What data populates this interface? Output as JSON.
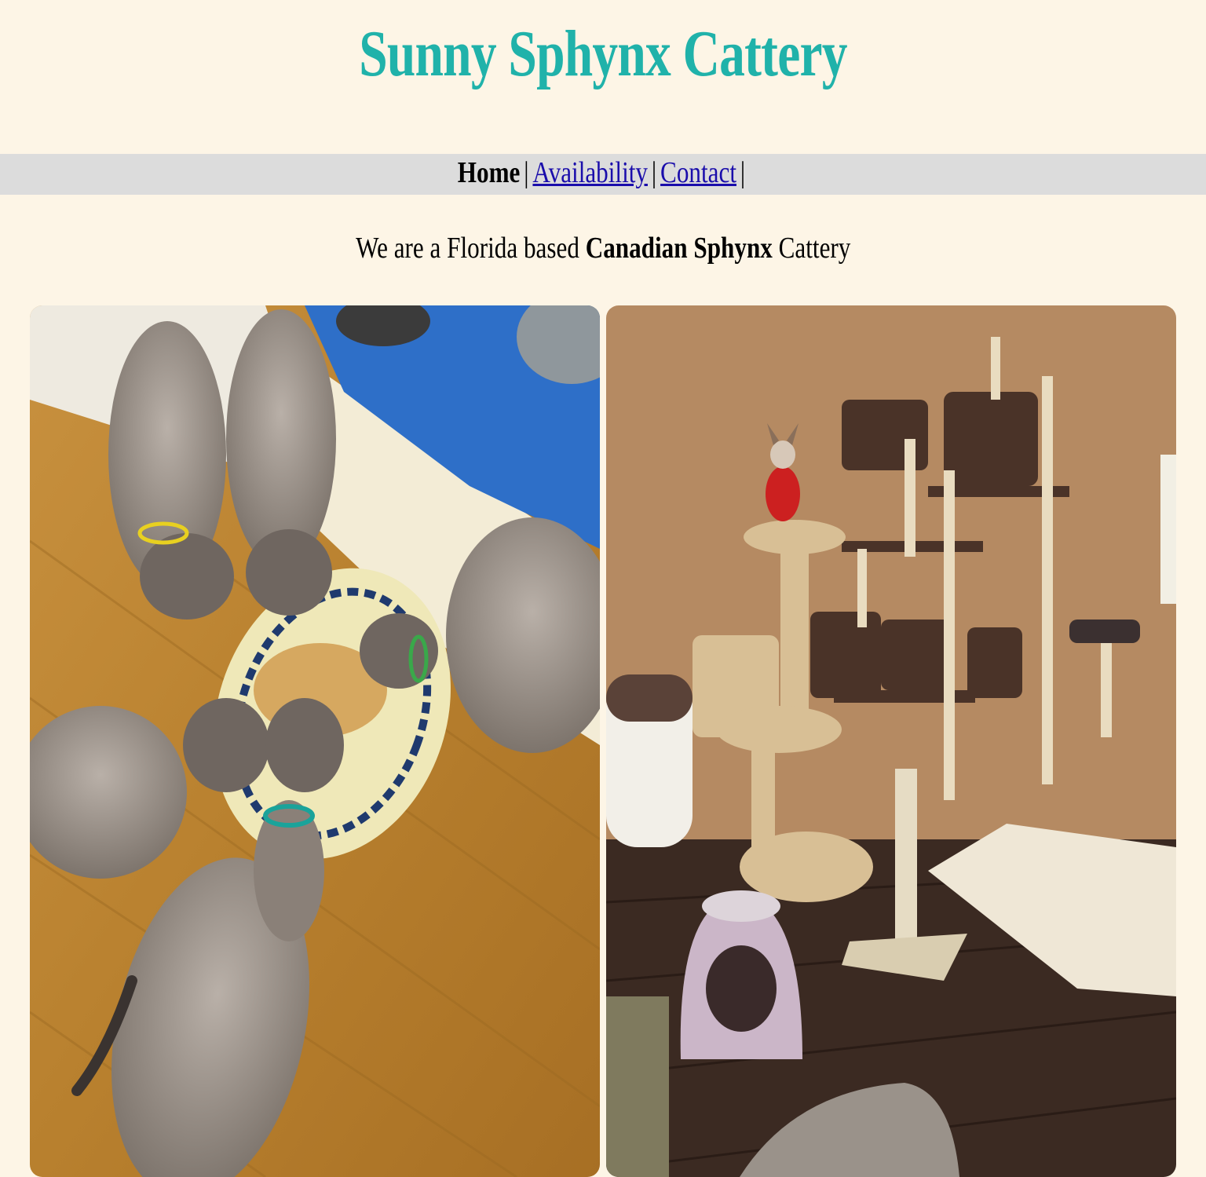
{
  "header": {
    "title": "Sunny Sphynx Cattery"
  },
  "nav": {
    "home_label": "Home",
    "separator": "|",
    "availability_label": "Availability",
    "contact_label": "Contact"
  },
  "intro": {
    "prefix": "We are a Florida based",
    "highlight": "Canadian Sphynx",
    "suffix": "Cattery"
  },
  "photos": [
    {
      "subject": "sphynx-kittens-eating-photo"
    },
    {
      "subject": "cat-trees-room-photo"
    }
  ],
  "colors": {
    "background": "#fdf5e6",
    "title": "#20b2aa",
    "nav_bar": "#dcdcdc",
    "link": "#1a0dab"
  }
}
